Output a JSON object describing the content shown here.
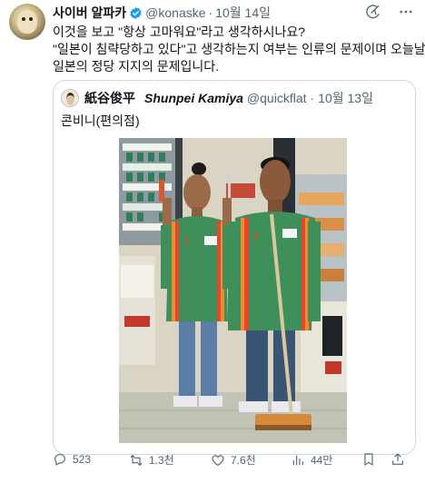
{
  "tweet": {
    "author": {
      "display_name": "사이버 알파카",
      "handle": "@konaske",
      "time": "10월 14일",
      "verified": true
    },
    "text_lines": [
      "이것을 보고 \"항상 고마워요\"라고 생각하시나요?",
      "\"일본이 침략당하고 있다\"고 생각하는지 여부는 인류의 문제이며 오늘날",
      "일본의 정당 지지의 문제입니다."
    ],
    "quoted": {
      "name_jp": "紙谷俊平",
      "name_en": "Shunpei Kamiya",
      "handle": "@quickflat",
      "time": "10월 13일",
      "text": "콘비니(편의점)",
      "image_signs": {
        "left_badge": "7",
        "right_badge": "7"
      }
    },
    "actions": {
      "reply_count": "523",
      "retweet_count": "1.3천",
      "like_count": "7.6천",
      "view_count": "44만"
    },
    "icons": {
      "grok": "grok-icon",
      "more": "more-icon",
      "reply": "reply-icon",
      "retweet": "retweet-icon",
      "like": "heart-icon",
      "views": "views-icon",
      "bookmark": "bookmark-icon",
      "share": "share-icon"
    }
  }
}
